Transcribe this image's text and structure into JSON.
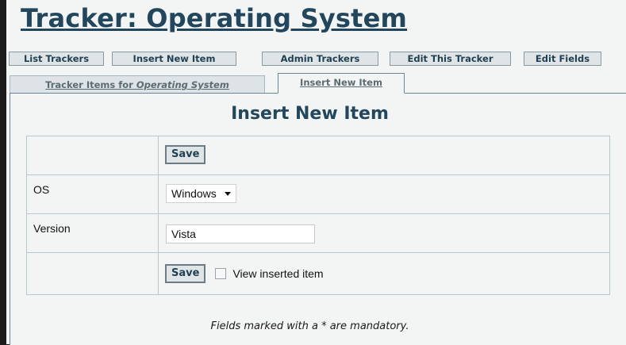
{
  "page": {
    "title": "Tracker: Operating System"
  },
  "toolbar": {
    "buttons": [
      {
        "label": "List Trackers"
      },
      {
        "label": "Insert New Item"
      },
      {
        "label": "Admin Trackers"
      },
      {
        "label": "Edit This Tracker"
      },
      {
        "label": "Edit Fields"
      }
    ]
  },
  "tabs": {
    "items_prefix": "Tracker Items for ",
    "items_name": "Operating System",
    "insert_label": "Insert New Item"
  },
  "form": {
    "heading": "Insert New Item",
    "save_label": "Save",
    "fields": [
      {
        "label": "OS",
        "value": "Windows"
      },
      {
        "label": "Version",
        "value": "Vista"
      }
    ],
    "view_inserted_label": "View inserted item",
    "footnote": "Fields marked with a * are mandatory."
  },
  "colors": {
    "accent": "#22475d",
    "border": "#b9c8cf",
    "button_bg": "#dfe4e6"
  }
}
